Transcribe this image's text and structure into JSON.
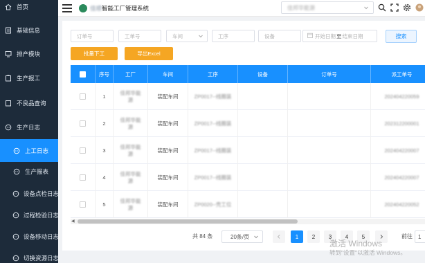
{
  "sidebar": {
    "items": [
      {
        "label": "首页",
        "icon": "home-icon"
      },
      {
        "label": "基础信息",
        "icon": "document-icon"
      },
      {
        "label": "排产模块",
        "icon": "screen-icon"
      },
      {
        "label": "生产报工",
        "icon": "clipboard-icon"
      },
      {
        "label": "不良品查询",
        "icon": "clipboard-icon"
      },
      {
        "label": "生产日志",
        "icon": "chat-icon"
      },
      {
        "label": "上工日志",
        "icon": "chat-icon"
      },
      {
        "label": "生产报表",
        "icon": "chat-icon"
      },
      {
        "label": "设备点检日志",
        "icon": "chat-icon"
      },
      {
        "label": "过程检验日志",
        "icon": "chat-icon"
      },
      {
        "label": "设备移动日志",
        "icon": "chat-icon"
      },
      {
        "label": "切换资源日志",
        "icon": "chat-icon"
      }
    ]
  },
  "header": {
    "title_blurred": "佳顺",
    "title": "智能工厂管理系统",
    "factory_select": "佳邦华能源"
  },
  "filters": {
    "order_no": "订单号",
    "work_order_no": "工单号",
    "workshop": "车间",
    "process": "工序",
    "equipment": "设备",
    "start_date": "开始日期",
    "date_sep": "至",
    "end_date": "结束日期",
    "search_button": "搜索"
  },
  "actions": {
    "batch_stop": "批量下工",
    "export": "导出Excel"
  },
  "table": {
    "headers": [
      "序号",
      "工厂",
      "车间",
      "工序",
      "设备",
      "订单号",
      "派工单号"
    ],
    "rows": [
      {
        "no": "1",
        "factory": "佳邦华能源",
        "workshop": "装配车间",
        "process": "ZP0017--线圈装",
        "device": "",
        "order": "",
        "dispatch": "202404220059"
      },
      {
        "no": "2",
        "factory": "佳邦华能源",
        "workshop": "装配车间",
        "process": "ZP0017--线圈装",
        "device": "",
        "order": "",
        "dispatch": "202312200001"
      },
      {
        "no": "3",
        "factory": "佳邦华能源",
        "workshop": "装配车间",
        "process": "ZP0017--线圈装",
        "device": "",
        "order": "",
        "dispatch": "202404220007"
      },
      {
        "no": "4",
        "factory": "佳邦华能源",
        "workshop": "装配车间",
        "process": "ZP0017--线圈装",
        "device": "",
        "order": "",
        "dispatch": "202404220007"
      },
      {
        "no": "5",
        "factory": "佳邦华能源",
        "workshop": "装配车间",
        "process": "ZP0020--壳工位",
        "device": "",
        "order": "",
        "dispatch": "202404220052"
      }
    ]
  },
  "pagination": {
    "total": "共 84 条",
    "page_size": "20条/页",
    "pages": [
      "1",
      "2",
      "3",
      "4",
      "5"
    ],
    "current": "1",
    "goto_label": "前往",
    "goto_value": "1"
  },
  "watermark": {
    "line1": "激活 Windows",
    "line2": "转到\"设置\"以激活 Windows。"
  },
  "colors": {
    "sidebar_bg": "#1d2b3a",
    "primary": "#1890ff",
    "accent_orange": "#f5a623"
  }
}
